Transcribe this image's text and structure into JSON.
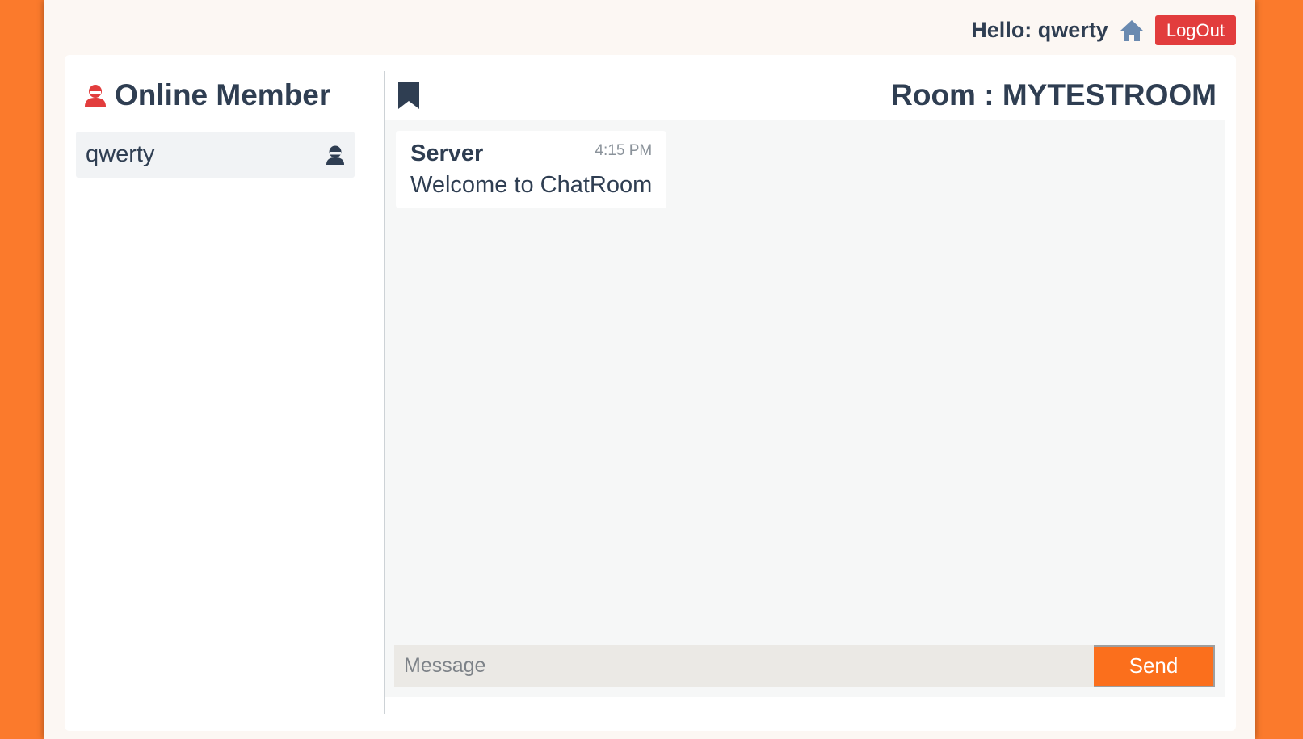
{
  "header": {
    "greeting": "Hello: qwerty",
    "home_icon": "home-icon",
    "logout_label": "LogOut"
  },
  "sidebar": {
    "title": "Online Member",
    "title_icon": "member-icon",
    "members": [
      {
        "name": "qwerty",
        "icon": "user-icon"
      }
    ]
  },
  "chat": {
    "header_icon": "bookmark-icon",
    "room_title": "Room : MYTESTROOM",
    "messages": [
      {
        "sender": "Server",
        "time": "4:15 PM",
        "text": "Welcome to ChatRoom"
      }
    ],
    "input_placeholder": "Message",
    "input_value": "",
    "send_label": "Send"
  },
  "colors": {
    "background_orange": "#fb7a2c",
    "logout_red": "#e23d3d",
    "send_orange": "#fb6f1c",
    "text_dark": "#2f3e52",
    "home_icon_blue": "#6a8ab0"
  }
}
